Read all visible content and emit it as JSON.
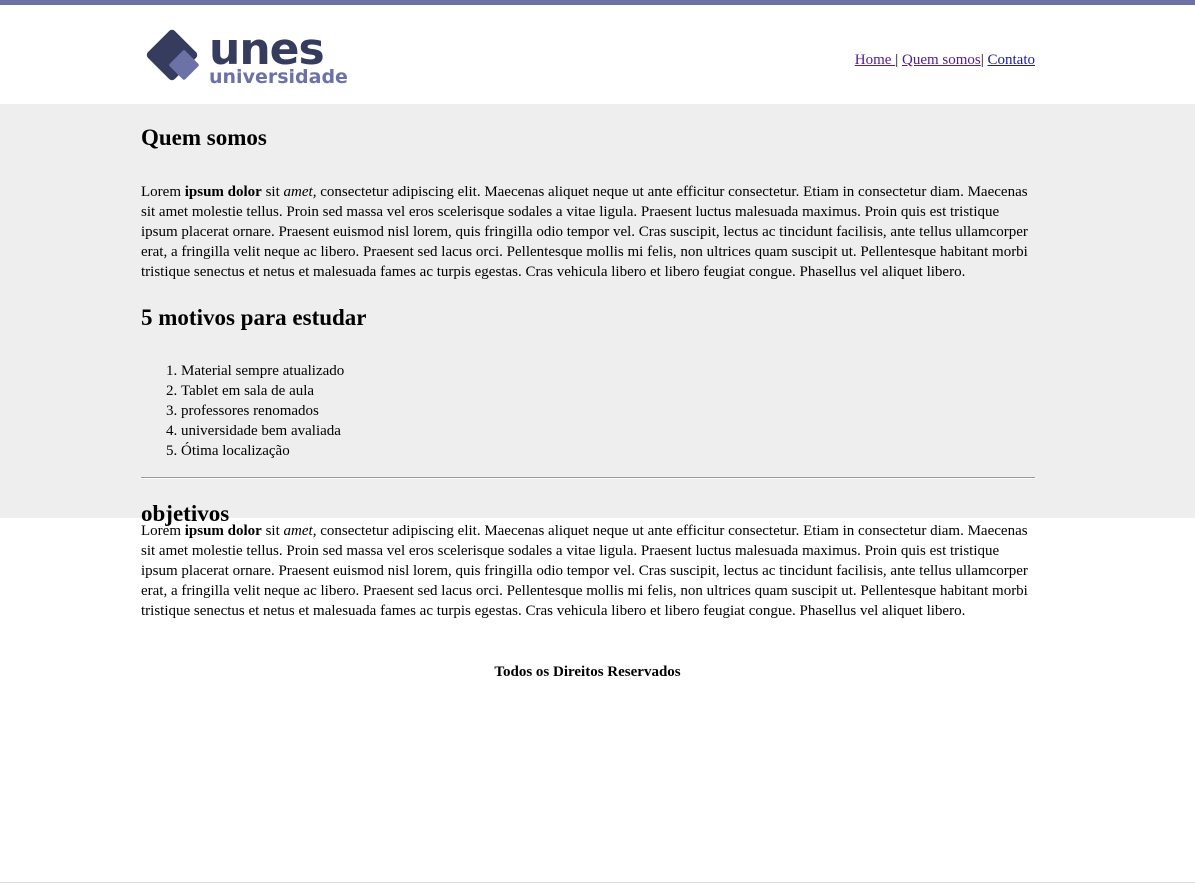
{
  "header": {
    "logo": {
      "text_main": "unes",
      "text_sub": "universidade"
    },
    "nav": {
      "items": [
        {
          "label": "Home "
        },
        {
          "label": "Quem somos"
        },
        {
          "label": "Contato"
        }
      ],
      "separator_1": "|",
      "separator_2": "|"
    }
  },
  "sections": {
    "quem_somos": {
      "title": "Quem somos",
      "paragraph": {
        "pre": "Lorem ",
        "bold": "ipsum dolor",
        "mid": " sit ",
        "italic": "amet,",
        "rest": " consectetur adipiscing elit. Maecenas aliquet neque ut ante efficitur consectetur. Etiam in consectetur diam. Maecenas sit amet molestie tellus. Proin sed massa vel eros scelerisque sodales a vitae ligula. Praesent luctus malesuada maximus. Proin quis est tristique ipsum placerat ornare. Praesent euismod nisl lorem, quis fringilla odio tempor vel. Cras suscipit, lectus ac tincidunt facilisis, ante tellus ullamcorper erat, a fringilla velit neque ac libero. Praesent sed lacus orci. Pellentesque mollis mi felis, non ultrices quam suscipit ut. Pellentesque habitant morbi tristique senectus et netus et malesuada fames ac turpis egestas. Cras vehicula libero et libero feugiat congue. Phasellus vel aliquet libero."
      }
    },
    "motivos": {
      "title": "5 motivos para estudar",
      "items": [
        "Material sempre atualizado",
        "Tablet em sala de aula",
        "professores renomados",
        "universidade bem avaliada",
        "Ótima localização"
      ]
    },
    "objetivos": {
      "title": "objetivos",
      "paragraph": {
        "pre": "Lorem ",
        "bold": "ipsum dolor",
        "mid": " sit ",
        "italic": "amet,",
        "rest": " consectetur adipiscing elit. Maecenas aliquet neque ut ante efficitur consectetur. Etiam in consectetur diam. Maecenas sit amet molestie tellus. Proin sed massa vel eros scelerisque sodales a vitae ligula. Praesent luctus malesuada maximus. Proin quis est tristique ipsum placerat ornare. Praesent euismod nisl lorem, quis fringilla odio tempor vel. Cras suscipit, lectus ac tincidunt facilisis, ante tellus ullamcorper erat, a fringilla velit neque ac libero. Praesent sed lacus orci. Pellentesque mollis mi felis, non ultrices quam suscipit ut. Pellentesque habitant morbi tristique senectus et netus et malesuada fames ac turpis egestas. Cras vehicula libero et libero feugiat congue. Phasellus vel aliquet libero."
      }
    }
  },
  "footer": {
    "text": "Todos os Direitos Reservados"
  },
  "colors": {
    "top_bar": "#6c72a6",
    "logo_dark": "#363c5e",
    "logo_light": "#6c72a6",
    "section_bg": "#eeeeee"
  }
}
